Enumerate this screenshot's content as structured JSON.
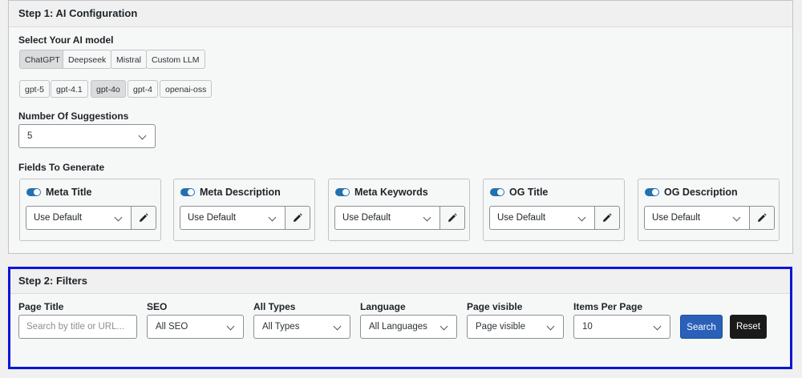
{
  "step1": {
    "title": "Step 1: AI Configuration",
    "model_label": "Select Your AI model",
    "providers": [
      "ChatGPT",
      "Deepseek",
      "Mistral",
      "Custom LLM"
    ],
    "active_provider": "ChatGPT",
    "models": [
      "gpt-5",
      "gpt-4.1",
      "gpt-4o",
      "gpt-4",
      "openai-oss"
    ],
    "active_model": "gpt-4o",
    "suggestions_label": "Number Of Suggestions",
    "suggestions_value": "5",
    "fields_label": "Fields To Generate",
    "fields": [
      {
        "title": "Meta Title",
        "enabled": true,
        "value": "Use Default"
      },
      {
        "title": "Meta Description",
        "enabled": true,
        "value": "Use Default"
      },
      {
        "title": "Meta Keywords",
        "enabled": true,
        "value": "Use Default"
      },
      {
        "title": "OG Title",
        "enabled": true,
        "value": "Use Default"
      },
      {
        "title": "OG Description",
        "enabled": true,
        "value": "Use Default"
      }
    ]
  },
  "step2": {
    "title": "Step 2: Filters",
    "page_title_label": "Page Title",
    "page_title_placeholder": "Search by title or URL...",
    "seo_label": "SEO",
    "seo_value": "All SEO",
    "types_label": "All Types",
    "types_value": "All Types",
    "language_label": "Language",
    "language_value": "All Languages",
    "visible_label": "Page visible",
    "visible_value": "Page visible",
    "items_label": "Items Per Page",
    "items_value": "10",
    "search_label": "Search",
    "reset_label": "Reset",
    "colors": {
      "search_bg": "#2a60b8",
      "reset_bg": "#1a1a1a",
      "highlight_border": "#0a16d8",
      "toggle": "#2271b1"
    }
  }
}
